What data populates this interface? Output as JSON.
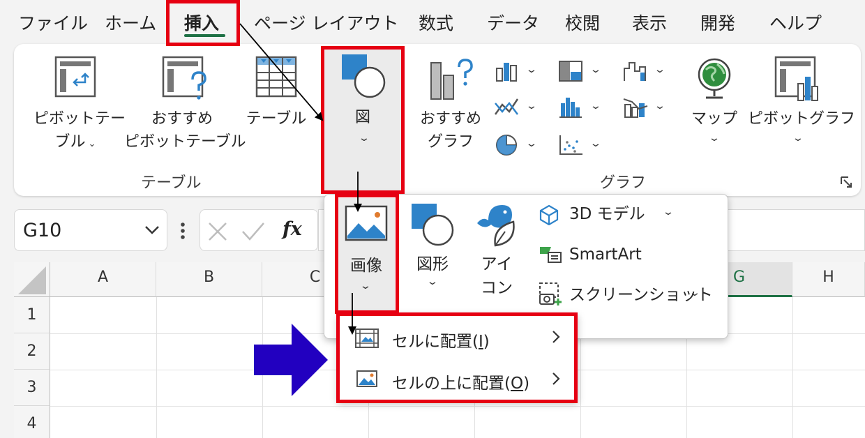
{
  "tabs": [
    "ファイル",
    "ホーム",
    "挿入",
    "ページ レイアウト",
    "数式",
    "データ",
    "校閲",
    "表示",
    "開発",
    "ヘルプ"
  ],
  "ribbon": {
    "pivot_table": [
      "ピボットテー",
      "ブル"
    ],
    "recommended_pivot": [
      "おすすめ",
      "ピボットテーブル"
    ],
    "table": "テーブル",
    "illustrations": "図",
    "recommended_charts": [
      "おすすめ",
      "グラフ"
    ],
    "maps": "マップ",
    "pivot_chart": "ピボットグラフ",
    "group_tables": "テーブル",
    "group_charts": "グラフ"
  },
  "formula_bar": {
    "name_box": "G10",
    "fx": "fx"
  },
  "grid": {
    "columns": [
      "A",
      "B",
      "C",
      "G",
      "H"
    ],
    "rows": [
      "1",
      "2",
      "3",
      "4"
    ]
  },
  "dropdown": {
    "picture": "画像",
    "shapes": "図形",
    "icons": [
      "アイ",
      "コン"
    ],
    "model_3d": "3D モデル",
    "smartart": "SmartArt",
    "screenshot": "スクリーンショット"
  },
  "submenu": {
    "place_in_cell": "セルに配置(",
    "place_in_cell_key": "I",
    "place_over_cells": "セルの上に配置(",
    "place_over_cells_key": "O",
    "close_paren": ")"
  },
  "colors": {
    "highlight": "#e60012",
    "accent_green": "#1e7145",
    "arrow_blue": "#2200c0",
    "icon_blue": "#2e83c9"
  }
}
